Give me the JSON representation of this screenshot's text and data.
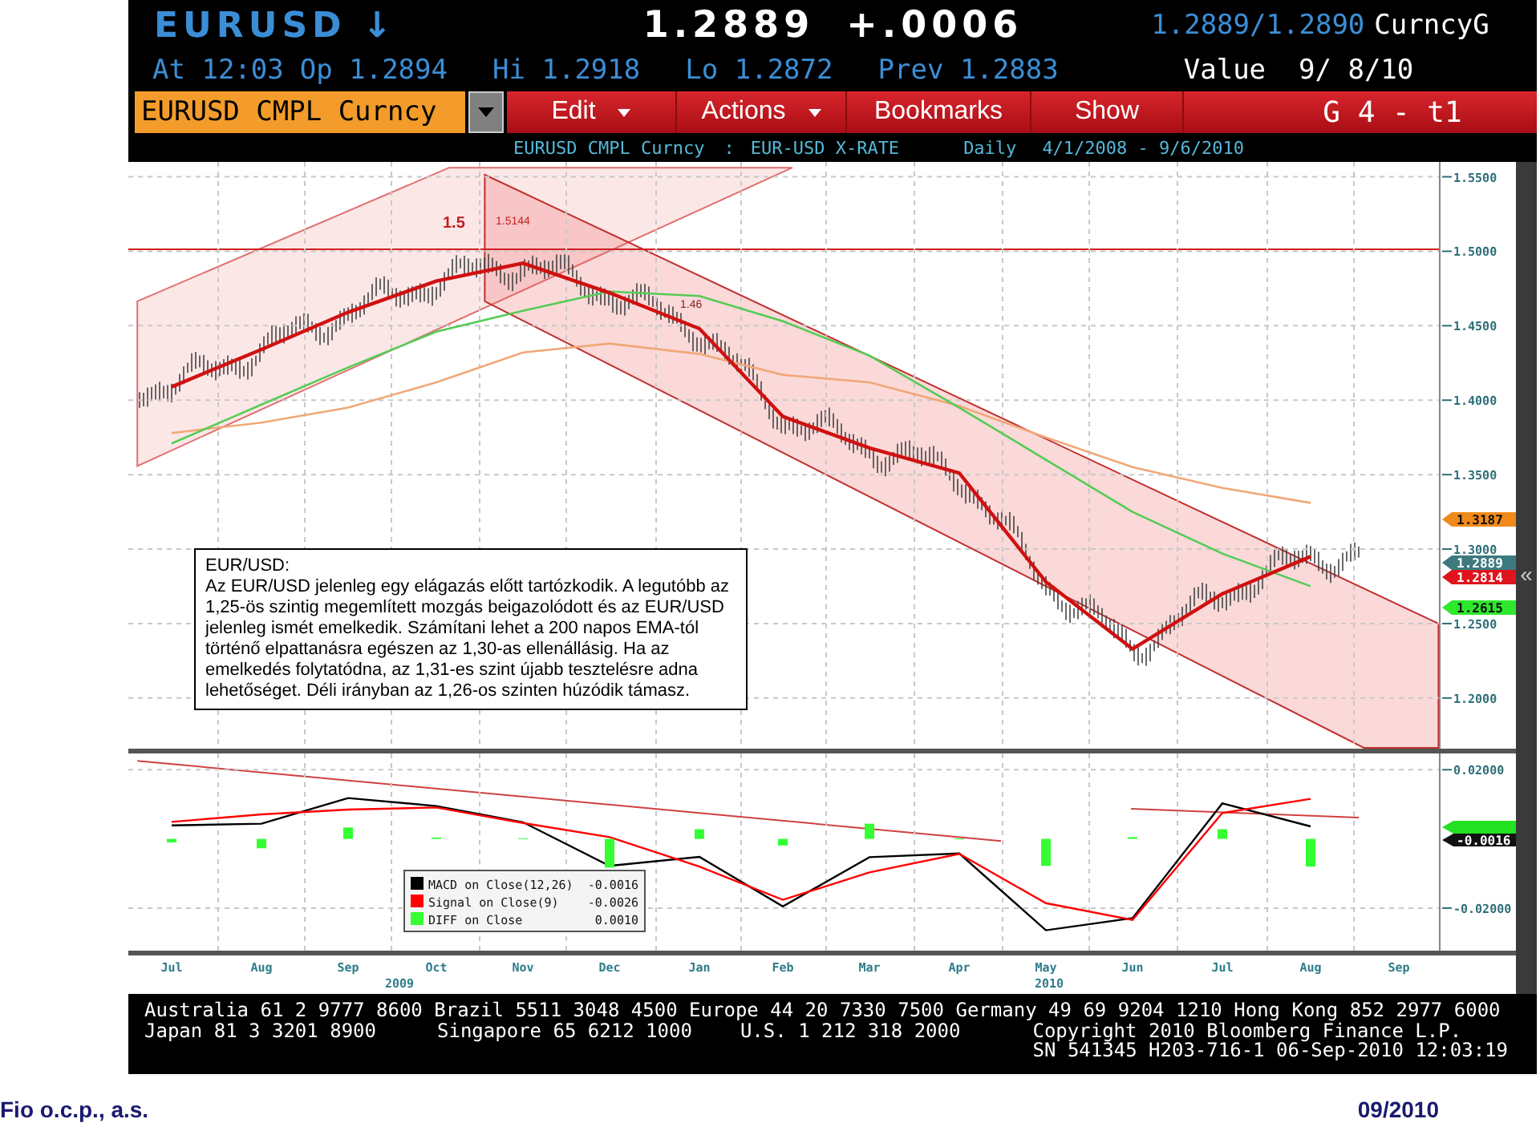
{
  "quote": {
    "ticker": "EURUSD",
    "direction": "↓",
    "last": "1.2889",
    "change": "+.0006",
    "bid_ask": "1.2889/1.2890",
    "market": "CurncyG",
    "time": "At 12:03",
    "open": "Op 1.2894",
    "high": "Hi 1.2918",
    "low": "Lo 1.2872",
    "prev": "Prev 1.2883",
    "value": "Value  9/ 8/10"
  },
  "toolbar": {
    "security": "EURUSD CMPL Curncy",
    "menus": [
      {
        "label": "Edit",
        "dropdown": true
      },
      {
        "label": "Actions",
        "dropdown": true
      },
      {
        "label": "Bookmarks",
        "dropdown": false
      },
      {
        "label": "Show",
        "dropdown": false
      }
    ],
    "page": "G 4 - t1"
  },
  "subtitle": {
    "security": "EURUSD CMPL Curncy",
    "separator": ":",
    "description": "EUR-USD X-RATE",
    "period": "Daily",
    "range": "4/1/2008 - 9/6/2010"
  },
  "price_chart": {
    "annotations": [
      "1.5",
      "1.5144",
      "1.46"
    ],
    "chart_data": {
      "type": "line",
      "ylim": [
        1.166,
        1.56
      ],
      "grid": true,
      "yticks": [
        {
          "value": 1.55,
          "label": "1.5500"
        },
        {
          "value": 1.5,
          "label": "1.5000"
        },
        {
          "value": 1.45,
          "label": "1.4500"
        },
        {
          "value": 1.4,
          "label": "1.4000"
        },
        {
          "value": 1.35,
          "label": "1.3500"
        },
        {
          "value": 1.3,
          "label": "1.3000"
        },
        {
          "value": 1.25,
          "label": "1.2500"
        },
        {
          "value": 1.2,
          "label": "1.2000"
        }
      ],
      "series": [
        {
          "color": "#f0a878",
          "values": [
            1.378,
            1.385,
            1.395,
            1.412,
            1.432,
            1.438,
            1.431,
            1.417,
            1.412,
            1.396,
            1.375,
            1.355,
            1.341,
            1.331,
            null
          ]
        },
        {
          "color": "#55cc55",
          "values": [
            1.371,
            1.397,
            1.422,
            1.446,
            1.46,
            1.473,
            1.47,
            1.453,
            1.43,
            1.395,
            1.36,
            1.325,
            1.297,
            1.275,
            null
          ]
        },
        {
          "color": "#d01010",
          "values": [
            1.409,
            1.434,
            1.459,
            1.48,
            1.492,
            1.472,
            1.448,
            1.389,
            1.368,
            1.351,
            1.278,
            1.233,
            1.27,
            1.295,
            null
          ]
        }
      ]
    },
    "price_tags": [
      {
        "label": "1.3187",
        "color": "#f08a1c"
      },
      {
        "label": "1.2889",
        "color": "#3d7a80"
      },
      {
        "label": "1.2814",
        "color": "#e0141c"
      },
      {
        "label": "1.2615",
        "color": "#2ee82e"
      }
    ],
    "comment": {
      "title": "EUR/USD:",
      "text": "Az EUR/USD jelenleg egy elágazás előtt tartózkodik. A legutóbb az 1,25-ös szintig megemlített mozgás beigazolódott és az EUR/USD jelenleg ismét emelkedik. Számítani lehet a 200 napos EMA-tól történő elpattanásra egészen az 1,30-as ellenállásig. Ha az emelkedés folytatódna, az 1,31-es szint újabb tesztelésre adna lehetőséget. Déli irányban az 1,26-os szinten húzódik támasz."
    }
  },
  "macd_chart": {
    "chart_data": {
      "type": "line",
      "x": [
        "Jul",
        "Aug",
        "Sep",
        "Oct",
        "Nov",
        "Dec",
        "Jan",
        "Feb",
        "Mar",
        "Apr",
        "May",
        "Jun",
        "Jul",
        "Aug",
        "Sep"
      ],
      "ylim": [
        -0.0323,
        0.0247
      ],
      "grid": true,
      "legend": "lower left",
      "yticks": [
        {
          "value": 0.02,
          "label": "0.02000"
        },
        {
          "value": -0.02,
          "label": "-0.02000"
        }
      ],
      "series": [
        {
          "name": "MACD on Close(12,26)",
          "color": "#000000",
          "values": [
            0.0039,
            0.0044,
            0.0118,
            0.0095,
            0.0048,
            -0.0078,
            -0.0052,
            -0.0195,
            -0.0053,
            -0.0042,
            -0.0264,
            -0.0229,
            0.0103,
            0.0036,
            null
          ]
        },
        {
          "name": "Signal on Close(9)",
          "color": "#ff0000",
          "values": [
            0.0049,
            0.0071,
            0.0085,
            0.0091,
            0.0046,
            0.0005,
            -0.008,
            -0.0176,
            -0.0097,
            -0.0043,
            -0.0186,
            -0.0234,
            0.0075,
            0.0116,
            null
          ]
        },
        {
          "name": "DIFF on Close",
          "type": "bar",
          "color": "#33ff33",
          "values": [
            -0.001,
            -0.0027,
            0.0033,
            0.0004,
            0.0002,
            -0.0083,
            0.0028,
            -0.0019,
            0.0044,
            0.0001,
            -0.0078,
            0.0005,
            0.0028,
            -0.008,
            null
          ]
        }
      ]
    },
    "legend_values": [
      "-0.0016",
      "-0.0026",
      "0.0010"
    ],
    "year_labels": [
      "2009",
      "2010"
    ],
    "tags": [
      {
        "color": "#22e022"
      },
      {
        "label": "-0.0016",
        "color": "#111111"
      }
    ]
  },
  "scroll_handle": "«",
  "contacts": {
    "line_1": "Australia 61 2 9777 8600 Brazil 5511 3048 4500 Europe 44 20 7330 7500 Germany 49 69 9204 1210 Hong Kong 852 2977 6000",
    "line_2": [
      "Japan 81 3 3201 8900",
      "Singapore 65 6212 1000",
      "U.S. 1 212 318 2000",
      "Copyright 2010 Bloomberg Finance L.P."
    ],
    "line_3": "SN 541345 H203-716-1 06-Sep-2010 12:03:19"
  },
  "page_footer": {
    "company": "Fio o.c.p., a.s.",
    "date": "09/2010"
  }
}
